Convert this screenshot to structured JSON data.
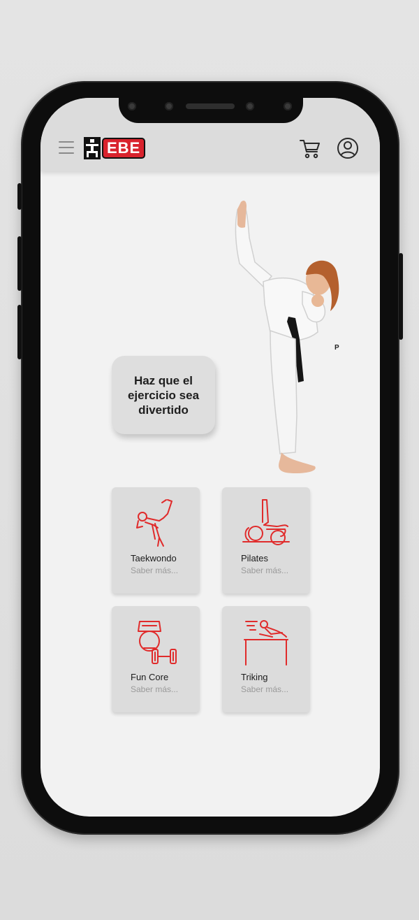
{
  "header": {
    "logo_text": "EBE",
    "icons": {
      "menu": "menu-icon",
      "cart": "cart-icon",
      "user": "user-icon"
    }
  },
  "hero": {
    "headline": "Haz que el ejercicio sea divertido"
  },
  "cards": [
    {
      "title": "Taekwondo",
      "link": "Saber más...",
      "icon": "taekwondo-kick-icon"
    },
    {
      "title": "Pilates",
      "link": "Saber más...",
      "icon": "pilates-icon"
    },
    {
      "title": "Fun Core",
      "link": "Saber más...",
      "icon": "kettlebell-dumbbell-icon"
    },
    {
      "title": "Triking",
      "link": "Saber más...",
      "icon": "triking-icon"
    }
  ],
  "colors": {
    "brand_red": "#d9232d",
    "icon_red": "#e02b2b",
    "screen_bg": "#f2f2f2",
    "header_bg": "#dcdcdc",
    "card_bg": "#dcdcdc"
  }
}
